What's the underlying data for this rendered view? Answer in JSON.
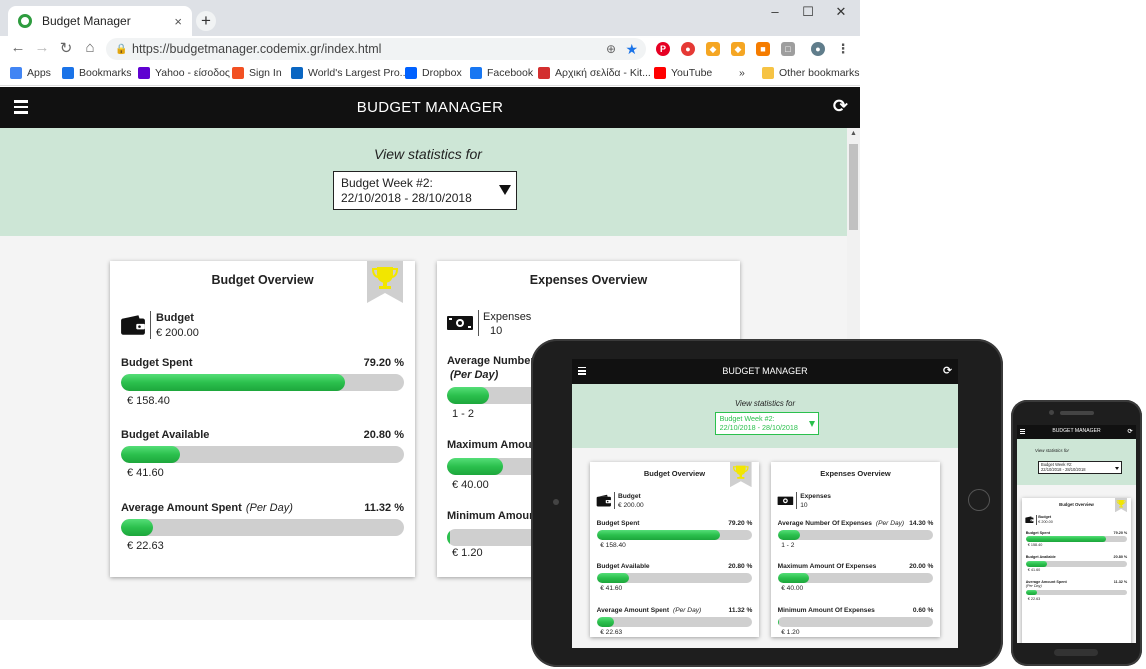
{
  "browser": {
    "tab_title": "Budget Manager",
    "tab_close": "×",
    "new_tab": "+",
    "url": "https://budgetmanager.codemix.gr/index.html",
    "window_controls": {
      "minimize": "–",
      "maximize": "☐",
      "close": "✕"
    },
    "bookmarks": [
      {
        "label": "Apps",
        "icon": "apps-grid-icon",
        "color": "#4285f4"
      },
      {
        "label": "Bookmarks",
        "icon": "star-icon",
        "color": "#1a73e8"
      },
      {
        "label": "Yahoo - είσοδος",
        "icon": "yahoo-icon",
        "color": "#5f01d1"
      },
      {
        "label": "Sign In",
        "icon": "windows-icon",
        "color": "#f25022"
      },
      {
        "label": "World's Largest Pro...",
        "icon": "linkedin-icon",
        "color": "#0a66c2"
      },
      {
        "label": "Dropbox",
        "icon": "dropbox-icon",
        "color": "#0061ff"
      },
      {
        "label": "Facebook",
        "icon": "facebook-icon",
        "color": "#1877f2"
      },
      {
        "label": "Αρχική σελίδα - Kit...",
        "icon": "kit-icon",
        "color": "#d32f2f"
      },
      {
        "label": "YouTube",
        "icon": "youtube-icon",
        "color": "#ff0000"
      }
    ],
    "bookmarks_overflow": "»",
    "other_bookmarks": "Other bookmarks"
  },
  "app": {
    "title": "BUDGET MANAGER",
    "stats_label": "View statistics for",
    "select_line1": "Budget Week #2:",
    "select_line2": "22/10/2018 - 28/10/2018",
    "accent_color": "#cde6d6",
    "progress_color": "#2bc04d",
    "budget_card": {
      "title": "Budget Overview",
      "badge_icon": "trophy-icon",
      "kv_label": "Budget",
      "kv_value": "€ 200.00",
      "metrics": [
        {
          "label": "Budget Spent",
          "percent": "79.20 %",
          "fraction": 0.792,
          "value": "€ 158.40"
        },
        {
          "label": "Budget Available",
          "percent": "20.80 %",
          "fraction": 0.208,
          "value": "€ 41.60"
        },
        {
          "label": "Average Amount Spent",
          "label_italic": "(Per Day)",
          "percent": "11.32 %",
          "fraction": 0.1132,
          "value": "€ 22.63"
        }
      ]
    },
    "expenses_card": {
      "title": "Expenses Overview",
      "kv_label": "Expenses",
      "kv_value": "10",
      "metrics": [
        {
          "label": "Average Number Of Expenses",
          "label_italic": "(Per Day)",
          "percent": "14.30 %",
          "fraction": 0.143,
          "value": "1 - 2"
        },
        {
          "label": "Maximum Amount Of Expenses",
          "percent": "20.00 %",
          "fraction": 0.2,
          "value": "€ 40.00"
        },
        {
          "label": "Minimum Amount Of Expenses",
          "percent": "0.60 %",
          "fraction": 0.006,
          "value": "€ 1.20"
        }
      ]
    }
  },
  "partial": {
    "avg_number": "Average Number",
    "per_day": "(Per Day)",
    "max_amount": "Maximum Amoun",
    "min_amount": "Minimum Amoun"
  }
}
